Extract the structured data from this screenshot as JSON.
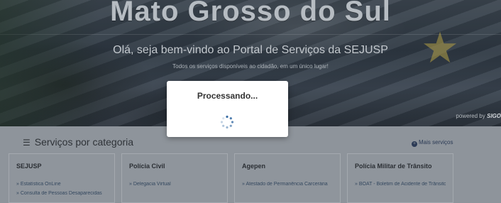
{
  "hero": {
    "title": "Mato Grosso do Sul",
    "welcome": "Olá, seja bem-vindo ao Portal de Serviços da SEJUSP",
    "tagline": "Todos os serviços disponíveis ao cidadão, em um único lugar!",
    "powered_by": "powered by",
    "powered_brand": "SIGO"
  },
  "services": {
    "heading": "Serviços por categoria",
    "more_label": "Mais serviços",
    "categories": [
      {
        "title": "SEJUSP",
        "links": [
          "» Estatística OnLine",
          "» Consulta de Pessoas Desaparecidas"
        ]
      },
      {
        "title": "Polícia Civil",
        "links": [
          "» Delegacia Virtual"
        ]
      },
      {
        "title": "Agepen",
        "links": [
          "» Atestado de Permanência Carcerária"
        ]
      },
      {
        "title": "Polícia Militar de Trânsito",
        "links": [
          "» BOAT - Boletim de Acidente de Trânsito"
        ]
      }
    ]
  },
  "modal": {
    "title": "Processando..."
  },
  "colors": {
    "overlay": "#8e949b",
    "modal_bg": "#ffffff",
    "spinner": "#3a6ea5"
  }
}
